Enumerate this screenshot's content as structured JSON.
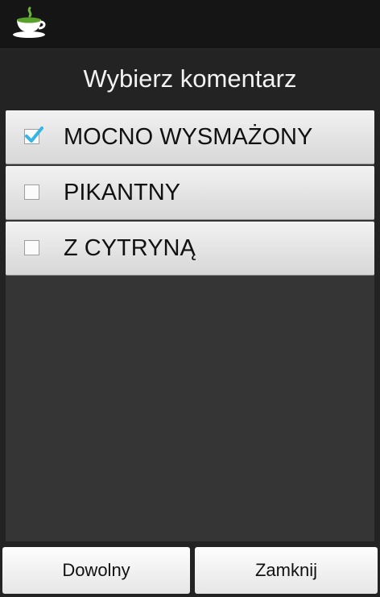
{
  "dialog": {
    "title": "Wybierz komentarz",
    "items": [
      {
        "label": "MOCNO WYSMAŻONY",
        "checked": true
      },
      {
        "label": "PIKANTNY",
        "checked": false
      },
      {
        "label": "Z CYTRYNĄ",
        "checked": false
      }
    ],
    "buttons": {
      "any": "Dowolny",
      "close": "Zamknij"
    }
  },
  "colors": {
    "check_accent": "#33b5e5",
    "app_icon_green": "#5aa02c"
  }
}
